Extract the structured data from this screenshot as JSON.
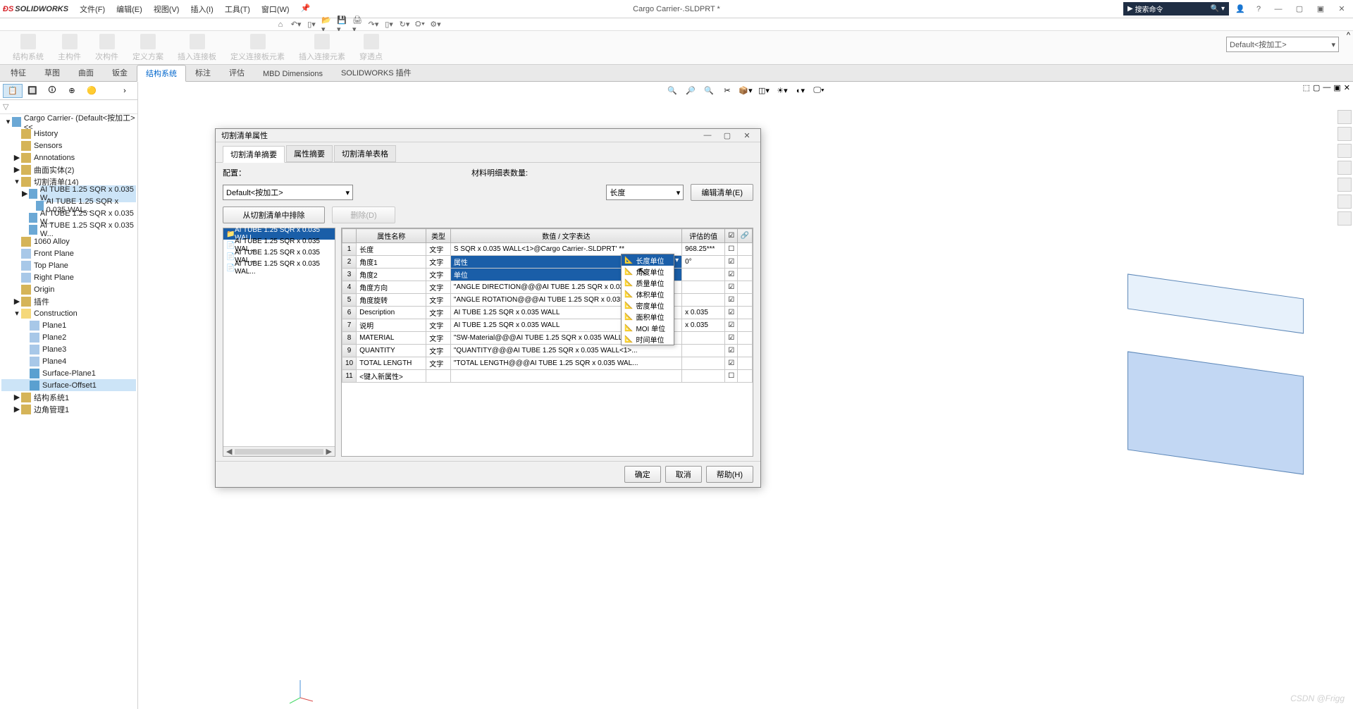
{
  "app": {
    "brand": "SOLIDWORKS",
    "doc_title": "Cargo Carrier-.SLDPRT *"
  },
  "menus": {
    "file": "文件(F)",
    "edit": "编辑(E)",
    "view": "视图(V)",
    "insert": "插入(I)",
    "tools": "工具(T)",
    "window": "窗口(W)"
  },
  "search": {
    "placeholder": "搜索命令"
  },
  "config_selector": "Default<按加工>",
  "ribbon_tabs": [
    "特征",
    "草图",
    "曲面",
    "钣金",
    "结构系统",
    "标注",
    "评估",
    "MBD Dimensions",
    "SOLIDWORKS 插件"
  ],
  "active_tab_index": 4,
  "ribbon_buttons": [
    "结构系统",
    "主构件",
    "次构件",
    "定义方案",
    "插入连接板",
    "定义连接板元素",
    "插入连接元素",
    "穿透点"
  ],
  "tree": {
    "root": "Cargo Carrier- (Default<按加工> <<",
    "items": [
      {
        "l": 1,
        "i": "ic-box",
        "t": "History"
      },
      {
        "l": 1,
        "i": "ic-box",
        "t": "Sensors"
      },
      {
        "l": 1,
        "i": "ic-box",
        "t": "Annotations",
        "exp": "▶"
      },
      {
        "l": 1,
        "i": "ic-box",
        "t": "曲面实体(2)",
        "exp": "▶"
      },
      {
        "l": 1,
        "i": "ic-box",
        "t": "切割清单(14)",
        "exp": "▾"
      },
      {
        "l": 2,
        "i": "ic-part",
        "t": "AI TUBE 1.25 SQR x 0.035 W...",
        "exp": "▶",
        "hl": true
      },
      {
        "l": 3,
        "i": "ic-part",
        "t": "AI TUBE 1.25 SQR x 0.035 WAL..."
      },
      {
        "l": 2,
        "i": "ic-part",
        "t": "AI TUBE 1.25 SQR x 0.035 W..."
      },
      {
        "l": 2,
        "i": "ic-part",
        "t": "AI TUBE 1.25 SQR x 0.035 W..."
      },
      {
        "l": 1,
        "i": "ic-box",
        "t": "1060 Alloy"
      },
      {
        "l": 1,
        "i": "ic-plane",
        "t": "Front Plane"
      },
      {
        "l": 1,
        "i": "ic-plane",
        "t": "Top Plane"
      },
      {
        "l": 1,
        "i": "ic-plane",
        "t": "Right Plane"
      },
      {
        "l": 1,
        "i": "ic-box",
        "t": "Origin"
      },
      {
        "l": 1,
        "i": "ic-box",
        "t": "插件",
        "exp": "▶"
      },
      {
        "l": 1,
        "i": "ic-folder",
        "t": "Construction",
        "exp": "▾"
      },
      {
        "l": 2,
        "i": "ic-plane",
        "t": "Plane1"
      },
      {
        "l": 2,
        "i": "ic-plane",
        "t": "Plane2"
      },
      {
        "l": 2,
        "i": "ic-plane",
        "t": "Plane3"
      },
      {
        "l": 2,
        "i": "ic-plane",
        "t": "Plane4"
      },
      {
        "l": 2,
        "i": "ic-sel",
        "t": "Surface-Plane1"
      },
      {
        "l": 2,
        "i": "ic-sel",
        "t": "Surface-Offset1",
        "sel": true
      },
      {
        "l": 1,
        "i": "ic-box",
        "t": "结构系统1",
        "exp": "▶"
      },
      {
        "l": 1,
        "i": "ic-box",
        "t": "边角管理1",
        "exp": "▶"
      }
    ]
  },
  "dialog": {
    "title": "切割清单属性",
    "tabs": [
      "切割清单摘要",
      "属性摘要",
      "切割清单表格"
    ],
    "active_tab": 0,
    "config_label": "配置：",
    "config_value": "Default<按加工>",
    "bom_label": "材料明细表数量:",
    "bom_value": "长度",
    "edit_list": "编辑清单(E)",
    "exclude_btn": "从切割清单中排除",
    "delete_btn": "删除(D)",
    "cutlist": [
      "AI TUBE 1.25 SQR x 0.035 WALL",
      "AI TUBE 1.25 SQR x 0.035 WAL...",
      "AI TUBE 1.25 SQR x 0.035 WAL...",
      "AI TUBE 1.25 SQR x 0.035 WAL..."
    ],
    "headers": {
      "name": "属性名称",
      "type": "类型",
      "expr": "数值 / 文字表达",
      "eval": "评估的值"
    },
    "rows": [
      {
        "n": "1",
        "name": "长度",
        "type": "文字",
        "expr": "S SQR x 0.035 WALL<1>@Cargo Carrier-.SLDPRT' **",
        "eval": "968.25***",
        "chk": false
      },
      {
        "n": "2",
        "name": "角度1",
        "type": "文字",
        "expr": "属性",
        "eval": "0°",
        "chk": true,
        "edit": true
      },
      {
        "n": "3",
        "name": "角度2",
        "type": "文字",
        "expr": "单位",
        "eval": "",
        "chk": true
      },
      {
        "n": "4",
        "name": "角度方向",
        "type": "文字",
        "expr": "\"ANGLE DIRECTION@@@AI TUBE 1.25 SQR x 0.035 W...",
        "eval": "",
        "chk": true
      },
      {
        "n": "5",
        "name": "角度旋转",
        "type": "文字",
        "expr": "\"ANGLE ROTATION@@@AI TUBE 1.25 SQR x 0.035 W...",
        "eval": "",
        "chk": true
      },
      {
        "n": "6",
        "name": "Description",
        "type": "文字",
        "expr": "AI TUBE 1.25 SQR x 0.035 WALL",
        "eval": "x 0.035",
        "chk": true
      },
      {
        "n": "7",
        "name": "说明",
        "type": "文字",
        "expr": "AI TUBE 1.25 SQR x 0.035 WALL",
        "eval": "x 0.035",
        "chk": true
      },
      {
        "n": "8",
        "name": "MATERIAL",
        "type": "文字",
        "expr": "\"SW-Material@@@AI TUBE 1.25 SQR x 0.035 WALL...",
        "eval": "",
        "chk": true
      },
      {
        "n": "9",
        "name": "QUANTITY",
        "type": "文字",
        "expr": "\"QUANTITY@@@AI TUBE 1.25 SQR x 0.035 WALL<1>...",
        "eval": "",
        "chk": true
      },
      {
        "n": "10",
        "name": "TOTAL LENGTH",
        "type": "文字",
        "expr": "\"TOTAL LENGTH@@@AI TUBE 1.25 SQR x 0.035 WAL...",
        "eval": "",
        "chk": true
      },
      {
        "n": "11",
        "name": "<键入新属性>",
        "type": "",
        "expr": "",
        "eval": "",
        "chk": false
      }
    ],
    "unit_options": [
      "长度单位",
      "角度单位",
      "质量单位",
      "体积单位",
      "密度单位",
      "面积单位",
      "MOI 单位",
      "时间单位"
    ],
    "unit_selected": 0,
    "buttons": {
      "ok": "确定",
      "cancel": "取消",
      "help": "帮助(H)"
    }
  },
  "watermark": "CSDN @Frigg"
}
